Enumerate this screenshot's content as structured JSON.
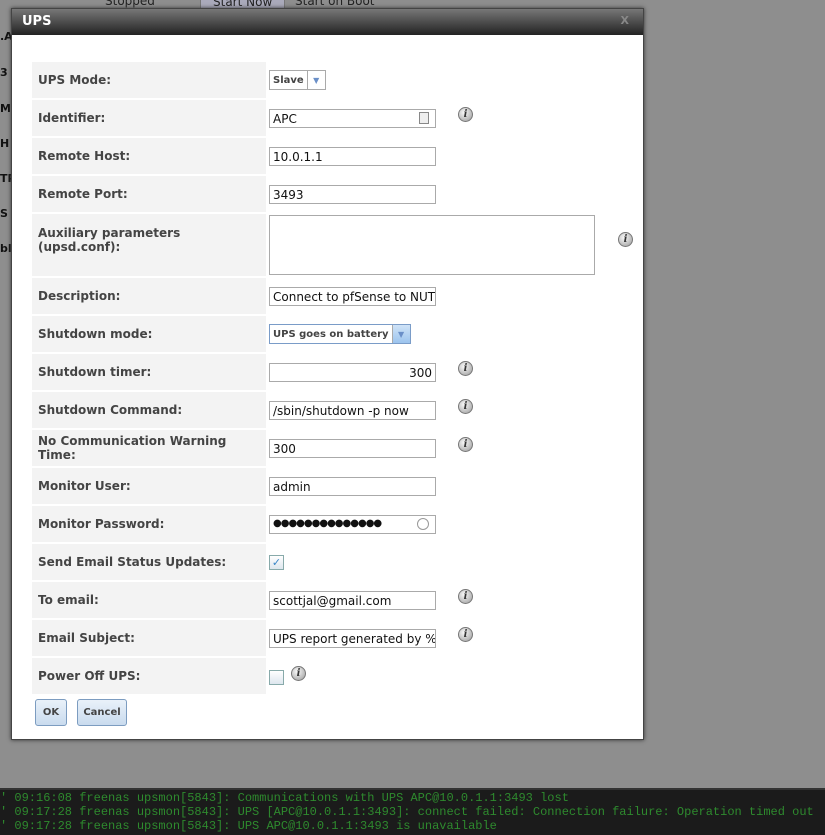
{
  "background": {
    "top": [
      "Stopped",
      "Start Now",
      "Start on Boot"
    ],
    "left": [
      ".A",
      "3",
      "MF",
      "H",
      "TP",
      "S",
      "bl"
    ]
  },
  "modal": {
    "title": "UPS",
    "close": "X"
  },
  "fields": {
    "ups_mode": {
      "label": "UPS Mode:",
      "value": "Slave"
    },
    "identifier": {
      "label": "Identifier:",
      "value": "APC"
    },
    "remote_host": {
      "label": "Remote Host:",
      "value": "10.0.1.1"
    },
    "remote_port": {
      "label": "Remote Port:",
      "value": "3493"
    },
    "aux": {
      "label": "Auxiliary parameters (upsd.conf):",
      "value": ""
    },
    "description": {
      "label": "Description:",
      "value": "Connect to pfSense to NUT"
    },
    "shutdown_mode": {
      "label": "Shutdown mode:",
      "value": "UPS goes on battery"
    },
    "shutdown_timer": {
      "label": "Shutdown timer:",
      "value": "300"
    },
    "shutdown_command": {
      "label": "Shutdown Command:",
      "value": "/sbin/shutdown -p now"
    },
    "nocomm": {
      "label": "No Communication Warning Time:",
      "value": "300"
    },
    "monitor_user": {
      "label": "Monitor User:",
      "value": "admin"
    },
    "monitor_password": {
      "label": "Monitor Password:",
      "value": "●●●●●●●●●●●●●●"
    },
    "send_email": {
      "label": "Send Email Status Updates:",
      "checked": true
    },
    "to_email": {
      "label": "To email:",
      "value": "scottjal@gmail.com"
    },
    "email_subject": {
      "label": "Email Subject:",
      "value": "UPS report generated by %h"
    },
    "power_off": {
      "label": "Power Off UPS:",
      "checked": false
    }
  },
  "buttons": {
    "ok": "OK",
    "cancel": "Cancel"
  },
  "log": [
    "' 09:16:08 freenas upsmon[5843]: Communications with UPS APC@10.0.1.1:3493 lost",
    "' 09:17:28 freenas upsmon[5843]: UPS [APC@10.0.1.1:3493]: connect failed: Connection failure: Operation timed out",
    "' 09:17:28 freenas upsmon[5843]: UPS APC@10.0.1.1:3493 is unavailable"
  ]
}
